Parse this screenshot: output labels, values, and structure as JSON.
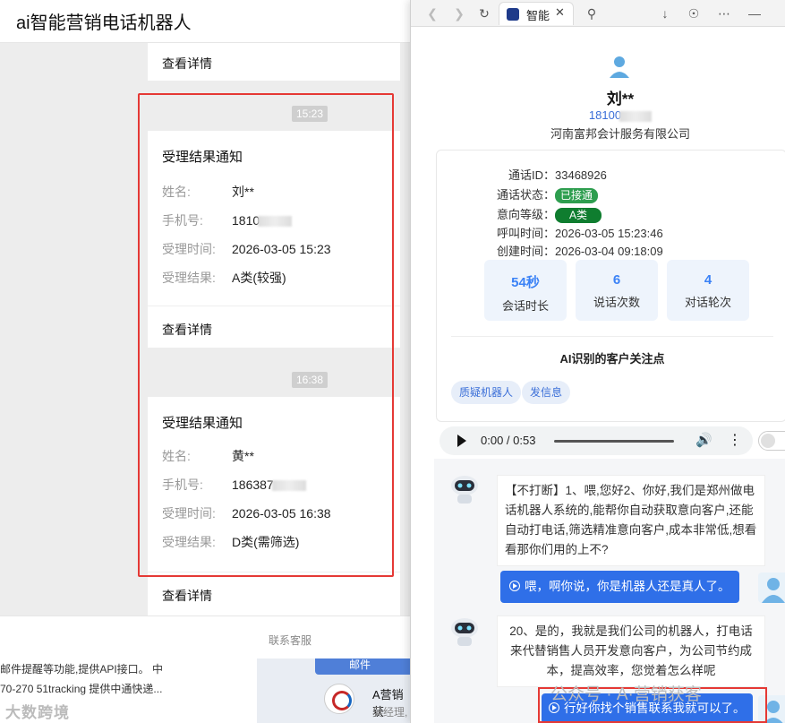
{
  "left": {
    "title": "ai智能营销电话机器人",
    "detail_link": "查看详情",
    "notices": [
      {
        "time": "15:23",
        "title": "受理结果通知",
        "rows": [
          {
            "k": "姓名:",
            "v": "刘**"
          },
          {
            "k": "手机号:",
            "v": "1810"
          },
          {
            "k": "受理时间:",
            "v": "2026-03-05 15:23"
          },
          {
            "k": "受理结果:",
            "v": "A类(较强)"
          }
        ],
        "link": "查看详情"
      },
      {
        "time": "16:38",
        "title": "受理结果通知",
        "rows": [
          {
            "k": "姓名:",
            "v": "黄**"
          },
          {
            "k": "手机号:",
            "v": "186387"
          },
          {
            "k": "受理时间:",
            "v": "2026-03-05 16:38"
          },
          {
            "k": "受理结果:",
            "v": "D类(需筛选)"
          }
        ],
        "link": "查看详情"
      }
    ],
    "footer": "联系客服",
    "bg_text1": "邮件提醒等功能,提供API接口。 中",
    "bg_text2": "70-270 51tracking 提供中通快递...",
    "bg_item_name": "A营销获",
    "bg_item_sub": "吴经理,",
    "watermark": "大数跨境"
  },
  "right": {
    "tab_label": "智能",
    "name": "刘**",
    "phone": "18100",
    "company": "河南富邦会计服务有限公司",
    "call_id_k": "通话ID：",
    "call_id_v": "33468926",
    "status_k": "通话状态：",
    "status_v": "已接通",
    "intent_k": "意向等级：",
    "intent_v": "A类",
    "call_time_k": "呼叫时间：",
    "call_time_v": "2026-03-05 15:23:46",
    "create_time_k": "创建时间：",
    "create_time_v": "2026-03-04 09:18:09",
    "stats": [
      {
        "n": "54秒",
        "l": "会话时长"
      },
      {
        "n": "6",
        "l": "说话次数"
      },
      {
        "n": "4",
        "l": "对话轮次"
      }
    ],
    "focus_title": "AI识别的客户关注点",
    "chips": [
      "质疑机器人",
      "发信息"
    ],
    "audio_time": "0:00 / 0:53",
    "colors": {
      "accent": "#3b82f6",
      "status_green": "#2e9e4f",
      "intent_green": "#0f7d2f",
      "bubble_blue": "#2f6fe8",
      "highlight_red": "#e53935"
    },
    "messages": [
      {
        "side": "bot",
        "text": "【不打断】1、喂,您好2、你好,我们是郑州做电话机器人系统的,能帮你自动获取意向客户,还能自动打电话,筛选精准意向客户,成本非常低,想看看那你们用的上不?"
      },
      {
        "side": "user",
        "text": "喂，啊你说，你是机器人还是真人了。"
      },
      {
        "side": "bot",
        "text": "20、是的，我就是我们公司的机器人，打电话来代替销售人员开发意向客户，为公司节约成本，提高效率，您觉着怎么样呢"
      },
      {
        "side": "user",
        "text": "行好你找个销售联系我就可以了。"
      }
    ],
    "watermark": "公众号 · A·营销获客"
  }
}
